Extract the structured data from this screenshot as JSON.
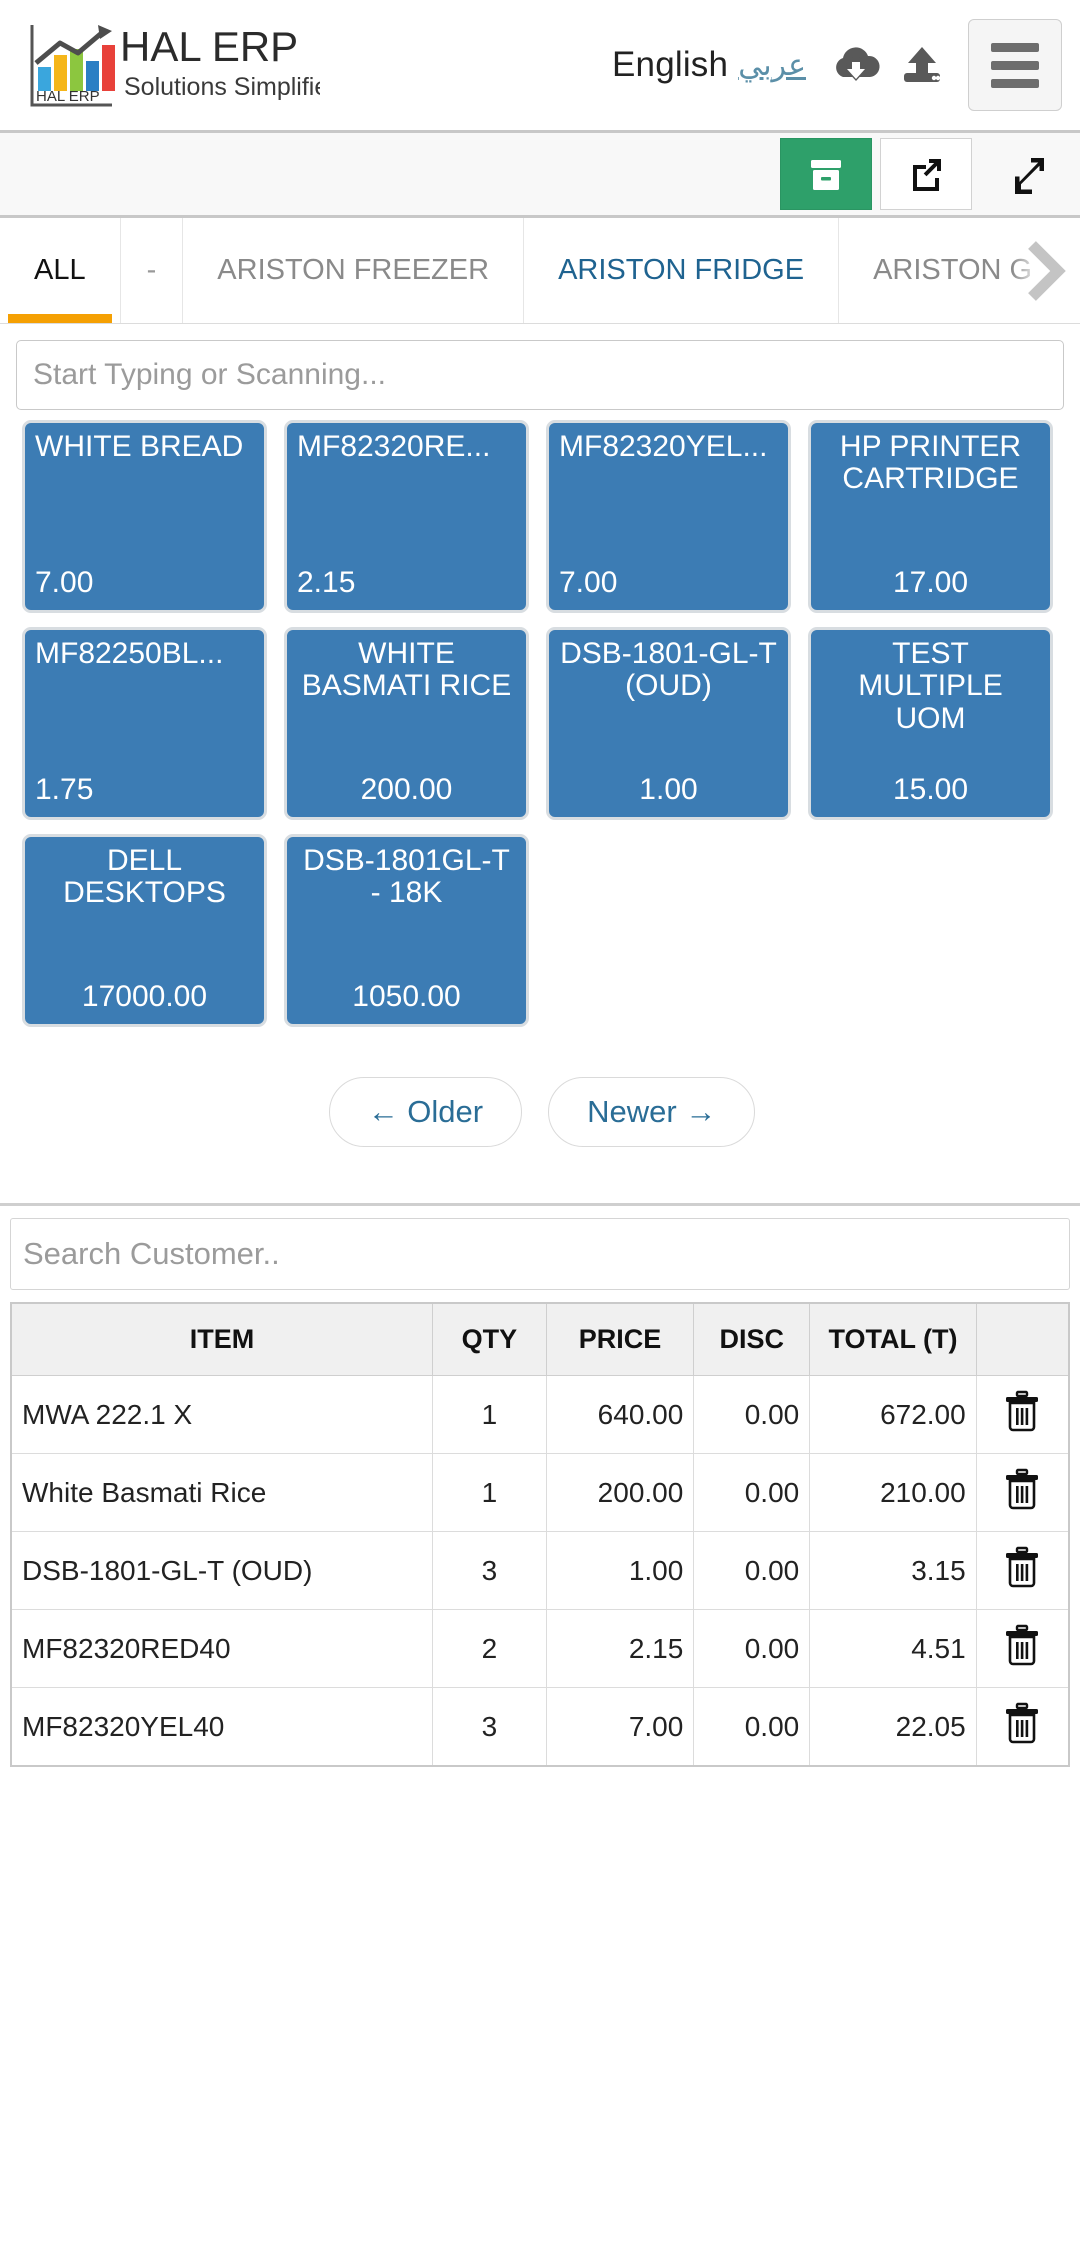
{
  "header": {
    "logo_title": "HAL ERP",
    "logo_tagline": "Solutions Simplified",
    "logo_mark_text": "HAL ERP",
    "language_current": "English",
    "language_alt": "عربي",
    "icons": {
      "download": "cloud-download-icon",
      "upload": "upload-icon",
      "menu": "hamburger-menu-icon"
    }
  },
  "toolbar": {
    "buttons": [
      {
        "name": "archive-button",
        "icon": "archive-box-icon",
        "active": true
      },
      {
        "name": "open-external-button",
        "icon": "external-link-icon",
        "active": false
      },
      {
        "name": "fullscreen-button",
        "icon": "expand-arrows-icon",
        "active": false
      }
    ],
    "accent_green": "#2ea06a"
  },
  "tabs": {
    "items": [
      {
        "label": "ALL",
        "state": "active"
      },
      {
        "label": "-",
        "state": "muted"
      },
      {
        "label": "ARISTON FREEZER",
        "state": "muted"
      },
      {
        "label": "ARISTON FRIDGE",
        "state": "link"
      },
      {
        "label": "ARISTON G",
        "state": "muted"
      }
    ],
    "scroll_next_icon": "chevron-right-icon",
    "active_underline_color": "#f5a003"
  },
  "item_search": {
    "placeholder": "Start Typing or Scanning...",
    "value": ""
  },
  "products": {
    "tile_color": "#3c7cb4",
    "items": [
      {
        "name": "WHITE BREAD",
        "price": "7.00",
        "align": "left"
      },
      {
        "name": "MF82320RE...",
        "price": "2.15",
        "align": "left"
      },
      {
        "name": "MF82320YEL...",
        "price": "7.00",
        "align": "left"
      },
      {
        "name": "HP PRINTER CARTRIDGE",
        "price": "17.00",
        "align": "center"
      },
      {
        "name": "MF82250BL...",
        "price": "1.75",
        "align": "left"
      },
      {
        "name": "WHITE BASMATI RICE",
        "price": "200.00",
        "align": "center"
      },
      {
        "name": "DSB-1801-GL-T (OUD)",
        "price": "1.00",
        "align": "center"
      },
      {
        "name": "TEST MULTIPLE UOM",
        "price": "15.00",
        "align": "center"
      },
      {
        "name": "DELL DESKTOPS",
        "price": "17000.00",
        "align": "center"
      },
      {
        "name": "DSB-1801GL-T - 18K",
        "price": "1050.00",
        "align": "center"
      }
    ]
  },
  "pagination": {
    "older_label": "← Older",
    "newer_label": "Newer →"
  },
  "customer_search": {
    "placeholder": "Search Customer..",
    "value": ""
  },
  "cart": {
    "columns": [
      "ITEM",
      "QTY",
      "PRICE",
      "DISC",
      "TOTAL (T)"
    ],
    "delete_icon": "trash-icon",
    "rows": [
      {
        "item": "MWA 222.1 X",
        "qty": "1",
        "price": "640.00",
        "disc": "0.00",
        "total": "672.00"
      },
      {
        "item": "White Basmati Rice",
        "qty": "1",
        "price": "200.00",
        "disc": "0.00",
        "total": "210.00"
      },
      {
        "item": "DSB-1801-GL-T (OUD)",
        "qty": "3",
        "price": "1.00",
        "disc": "0.00",
        "total": "3.15"
      },
      {
        "item": "MF82320RED40",
        "qty": "2",
        "price": "2.15",
        "disc": "0.00",
        "total": "4.51"
      },
      {
        "item": "MF82320YEL40",
        "qty": "3",
        "price": "7.00",
        "disc": "0.00",
        "total": "22.05"
      }
    ]
  }
}
